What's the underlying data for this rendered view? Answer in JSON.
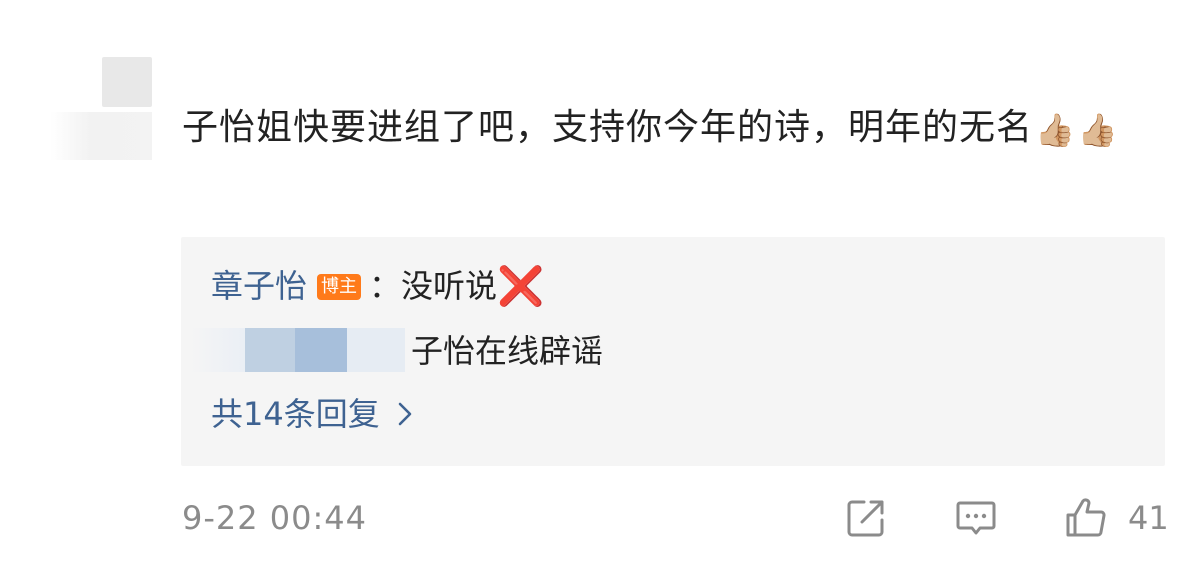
{
  "comment": {
    "text": "子怡姐快要进组了吧，支持你今年的诗，明年的无名",
    "emojis": [
      "👍🏼",
      "👍🏼"
    ]
  },
  "reply": {
    "author": "章子怡",
    "badge": "博主",
    "separator": "：",
    "text": "没听说",
    "mark": "❌",
    "second_text": "子怡在线辟谣",
    "more_replies": "共14条回复"
  },
  "footer": {
    "time": "9-22 00:44",
    "like_count": "41"
  },
  "icons": {
    "share": "share-icon",
    "comment": "comment-icon",
    "like": "thumbs-up-icon",
    "chevron": "chevron-right-icon"
  },
  "colors": {
    "link": "#3e6291",
    "badge": "#ff7a1a",
    "muted": "#8b8b8b",
    "reply_bg": "#f5f5f5"
  }
}
